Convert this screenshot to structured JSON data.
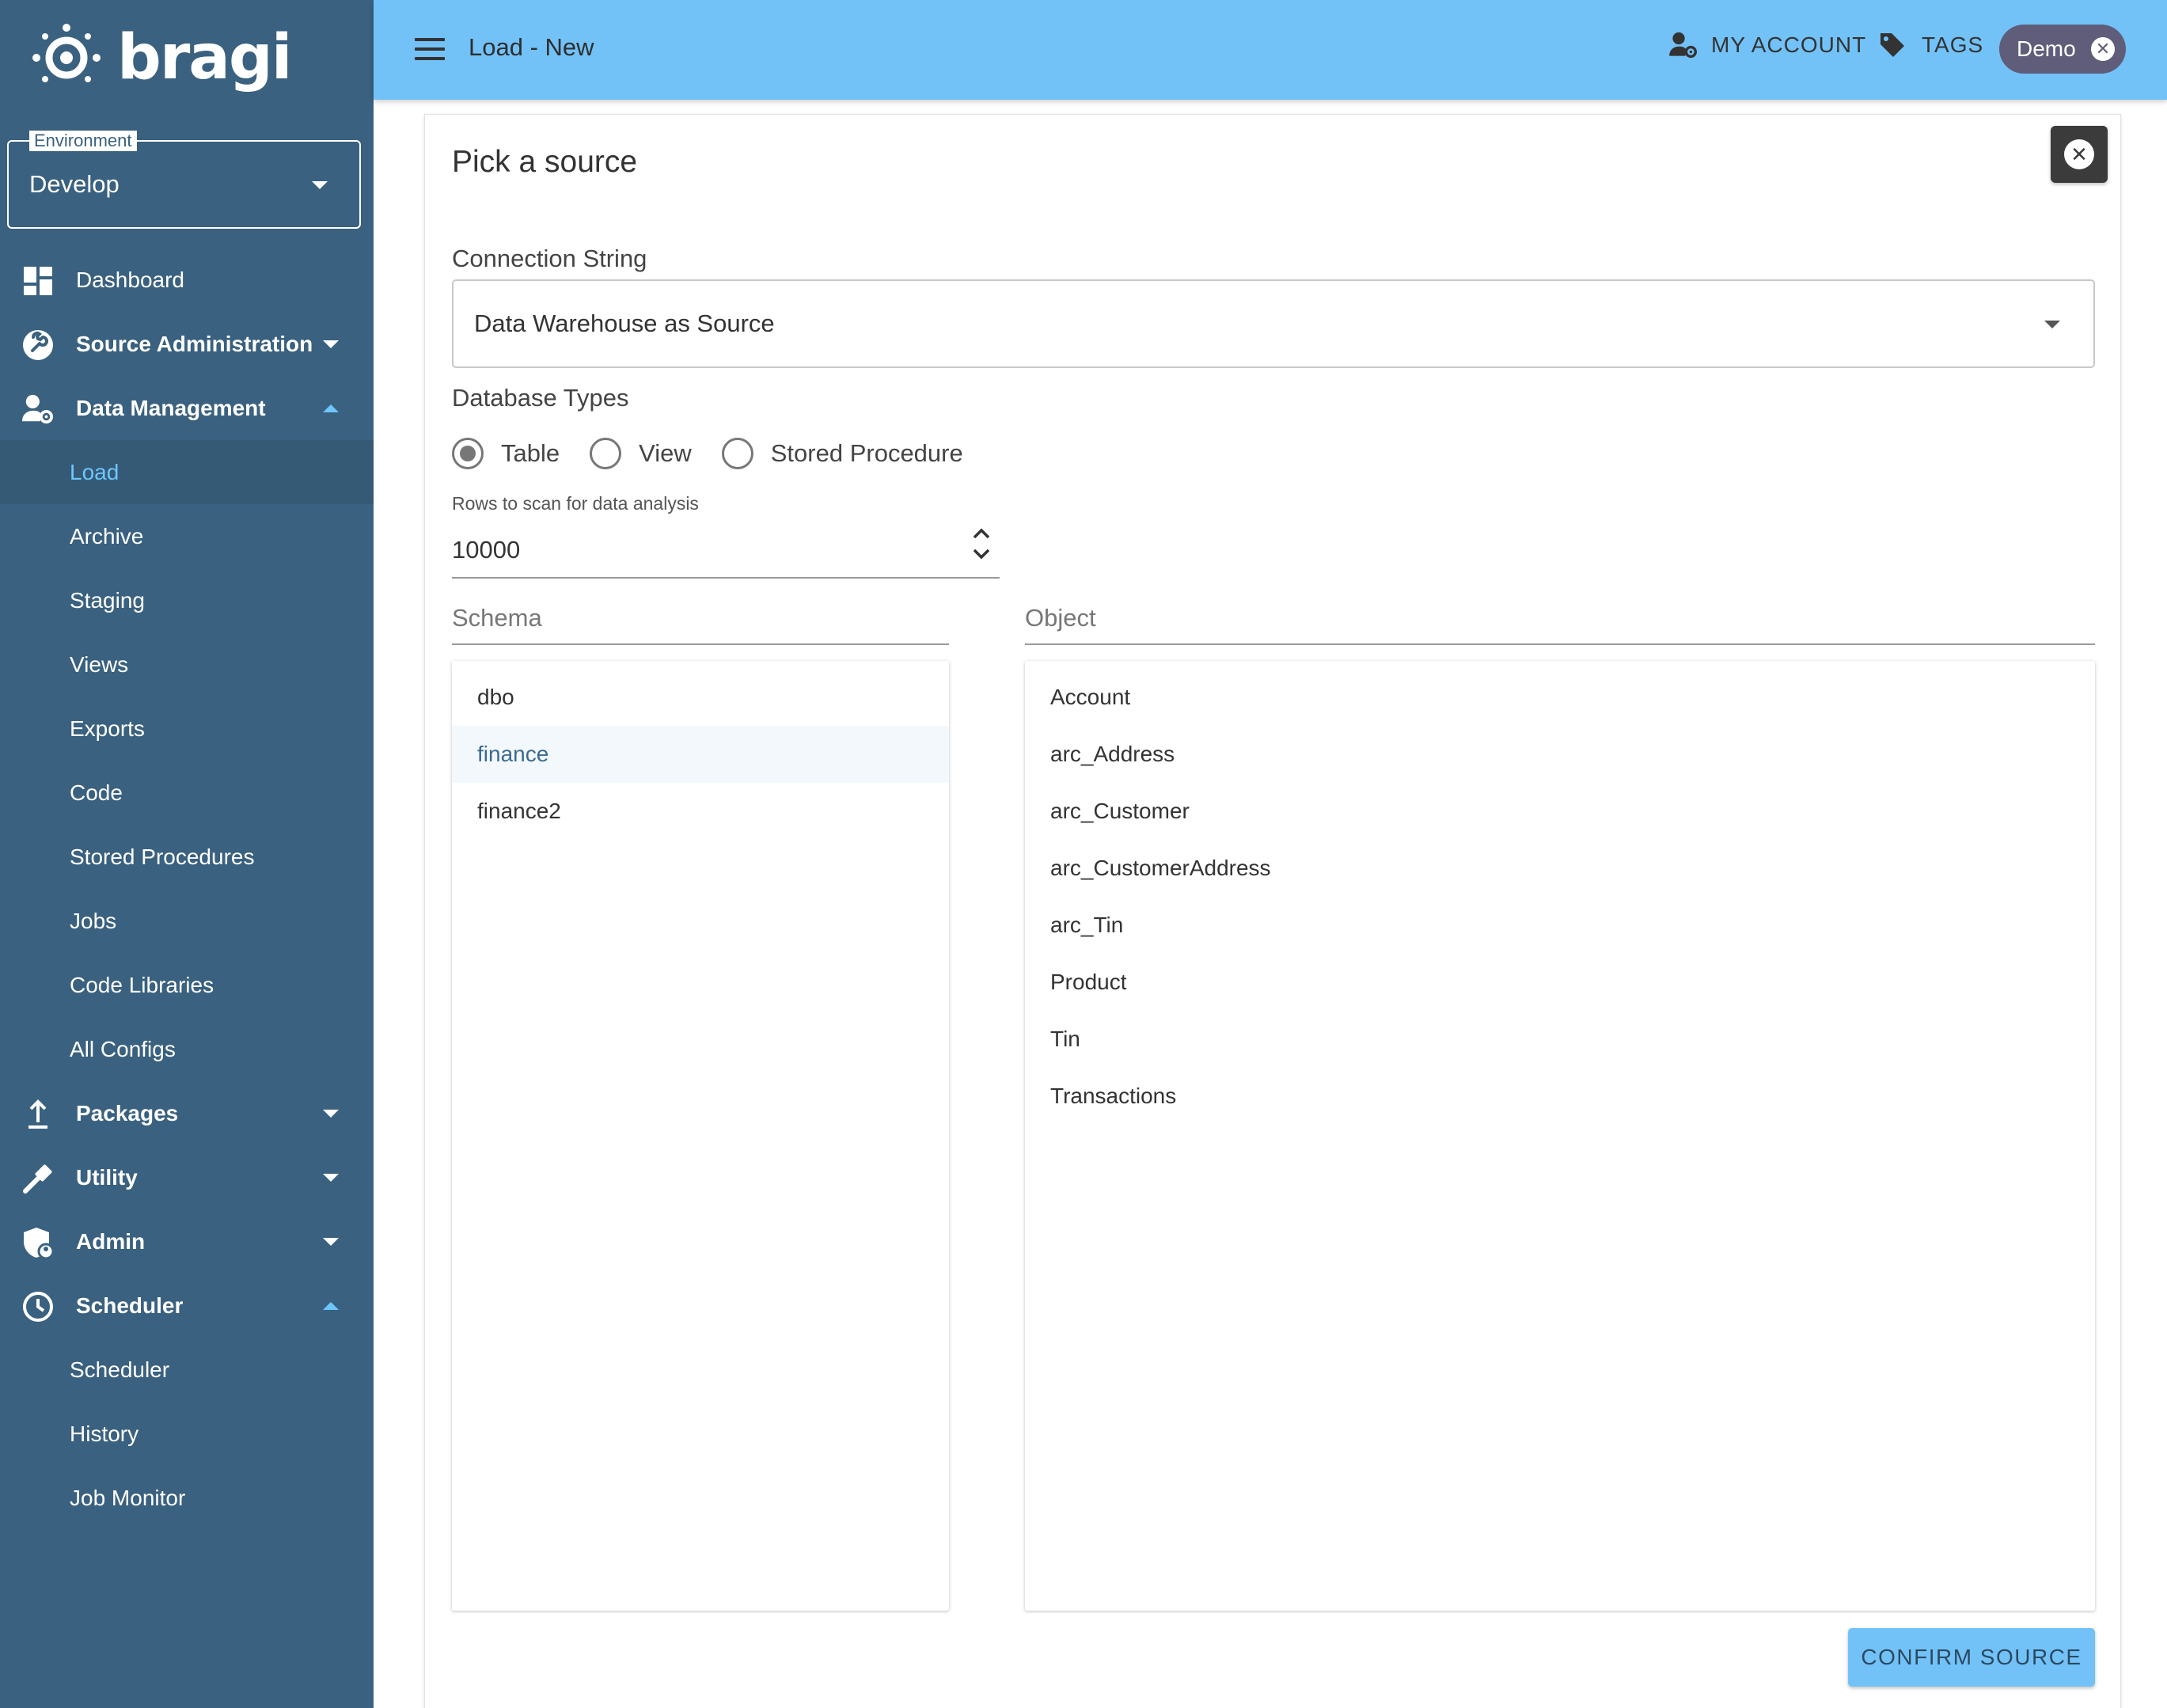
{
  "app": {
    "logo_text": "bragi",
    "colors": {
      "sidebar": "#3a617f",
      "header": "#72c2f8",
      "active_link": "#6ec6ff",
      "chip": "#5f5d7a"
    }
  },
  "environment": {
    "legend": "Environment",
    "value": "Develop"
  },
  "sidebar": {
    "dashboard": "Dashboard",
    "source_admin": "Source Administration",
    "data_management": "Data Management",
    "dm_items": [
      "Load",
      "Archive",
      "Staging",
      "Views",
      "Exports",
      "Code",
      "Stored Procedures",
      "Jobs",
      "Code Libraries",
      "All Configs"
    ],
    "packages": "Packages",
    "utility": "Utility",
    "admin": "Admin",
    "scheduler": "Scheduler",
    "scheduler_items": [
      "Scheduler",
      "History",
      "Job Monitor"
    ]
  },
  "header": {
    "title": "Load - New",
    "my_account": "MY ACCOUNT",
    "tags": "TAGS",
    "demo_chip": "Demo"
  },
  "panel": {
    "title": "Pick a source",
    "connection_label": "Connection String",
    "connection_value": "Data Warehouse as Source",
    "db_types_label": "Database Types",
    "db_types": [
      "Table",
      "View",
      "Stored Procedure"
    ],
    "db_type_selected": "Table",
    "rows_label": "Rows to scan for data analysis",
    "rows_value": "10000",
    "schema_label": "Schema",
    "schemas": [
      "dbo",
      "finance",
      "finance2"
    ],
    "schema_selected": "finance",
    "object_label": "Object",
    "objects": [
      "Account",
      "arc_Address",
      "arc_Customer",
      "arc_CustomerAddress",
      "arc_Tin",
      "Product",
      "Tin",
      "Transactions"
    ],
    "confirm_label": "CONFIRM SOURCE"
  }
}
